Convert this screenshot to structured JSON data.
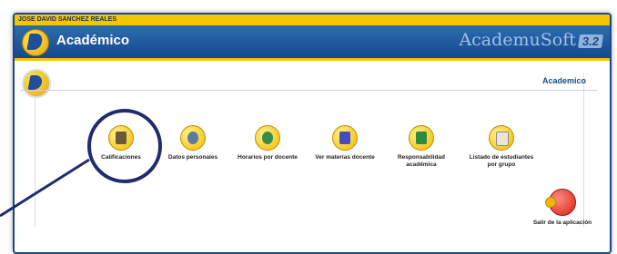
{
  "user": {
    "name": "JOSE DAVID SANCHEZ REALES"
  },
  "header": {
    "title": "Académico",
    "brand": "AcademuSoft",
    "version": "3.2"
  },
  "section": {
    "title": "Academico"
  },
  "menu": [
    {
      "label": "Calificaciones",
      "icon": "grades-notebook-icon",
      "glyph_color": "#6b5a3a"
    },
    {
      "label": "Datos personales",
      "icon": "personal-data-icon",
      "glyph_color": "#5a7aa0"
    },
    {
      "label": "Horarios por docente",
      "icon": "schedule-clock-icon",
      "glyph_color": "#3a8a4a"
    },
    {
      "label": "Ver materias docente",
      "icon": "teacher-subjects-icon",
      "glyph_color": "#4a4ac0"
    },
    {
      "label": "Responsabilidad académica",
      "icon": "academic-responsibility-icon",
      "glyph_color": "#2f8a3a"
    },
    {
      "label": "Listado de estudiantes por grupo",
      "icon": "student-list-icon",
      "glyph_color": "#e9e6d8"
    }
  ],
  "exit": {
    "label": "Salir de la aplicación",
    "icon": "exit-power-icon"
  },
  "colors": {
    "header_blue": "#1a4a86",
    "accent_yellow": "#f3c400",
    "highlight_navy": "#202c6b"
  }
}
